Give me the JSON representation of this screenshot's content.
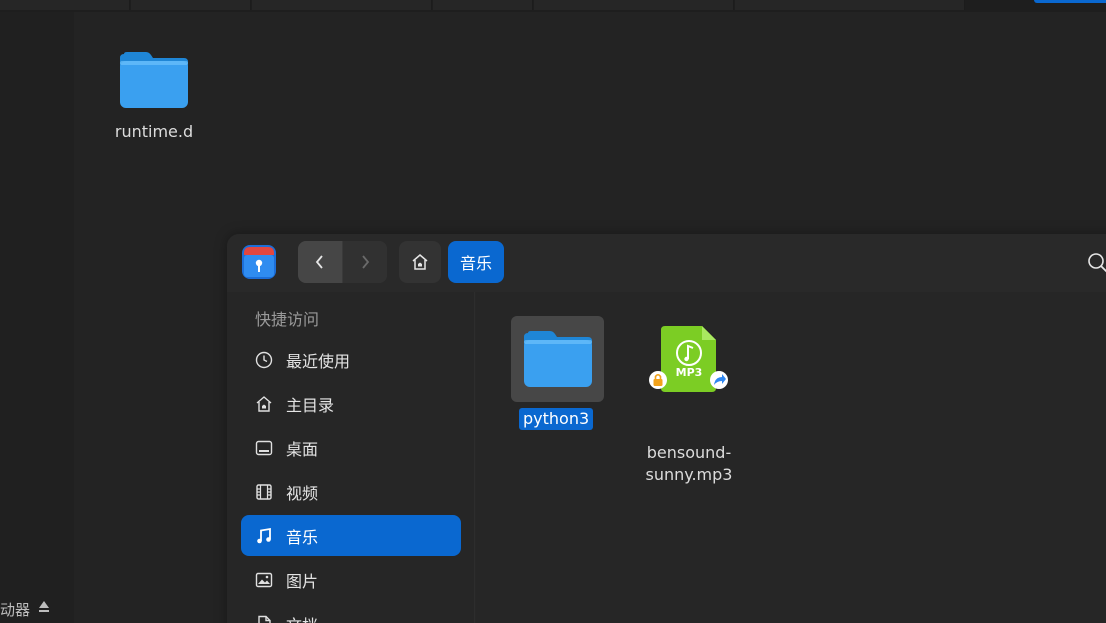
{
  "desktop": {
    "icons": [
      {
        "label": "runtime.d",
        "kind": "folder"
      }
    ],
    "device_partial_label": "动器"
  },
  "file_manager": {
    "breadcrumb": [
      {
        "label": "音乐"
      }
    ],
    "sidebar": {
      "section_title": "快捷访问",
      "items": [
        {
          "label": "最近使用",
          "icon": "clock-icon",
          "active": false
        },
        {
          "label": "主目录",
          "icon": "home-icon",
          "active": false
        },
        {
          "label": "桌面",
          "icon": "desktop-icon",
          "active": false
        },
        {
          "label": "视频",
          "icon": "film-icon",
          "active": false
        },
        {
          "label": "音乐",
          "icon": "music-note-icon",
          "active": true
        },
        {
          "label": "图片",
          "icon": "image-icon",
          "active": false
        },
        {
          "label": "文档",
          "icon": "document-icon",
          "active": false
        }
      ]
    },
    "files": [
      {
        "name": "python3",
        "kind": "folder",
        "selected": true
      },
      {
        "name_line1": "bensound-",
        "name_line2": "sunny.mp3",
        "kind": "mp3",
        "badge_text": "MP3"
      }
    ]
  },
  "colors": {
    "accent": "#0a68d0",
    "background": "#232323",
    "folder": "#3aa0f0",
    "mp3": "#7ccd24"
  }
}
